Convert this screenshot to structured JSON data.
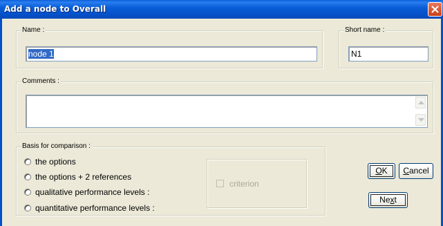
{
  "window": {
    "title": "Add a node to Overall",
    "close_label": "close"
  },
  "name": {
    "legend": "Name :",
    "value": "node 1"
  },
  "short_name": {
    "legend": "Short name :",
    "value": "N1"
  },
  "comments": {
    "legend": "Comments :",
    "value": ""
  },
  "basis": {
    "legend": "Basis for comparison :",
    "options": [
      {
        "label": "the options",
        "selected": false
      },
      {
        "label": "the options + 2 references",
        "selected": false
      },
      {
        "label": "qualitative performance levels :",
        "selected": false
      },
      {
        "label": "quantitative performance levels :",
        "selected": false
      }
    ],
    "criterion_label": "criterion",
    "criterion_checked": false,
    "criterion_enabled": false
  },
  "buttons": {
    "ok": {
      "mnemonic": "O",
      "rest": "K"
    },
    "cancel": {
      "mnemonic": "C",
      "rest": "ancel"
    },
    "next": {
      "before": "Ne",
      "mnemonic": "x",
      "after": "t"
    }
  },
  "colors": {
    "titlebar": "#0450c8",
    "dialog_bg": "#ece9d8",
    "selection": "#316ac5",
    "disabled_text": "#aca899"
  }
}
